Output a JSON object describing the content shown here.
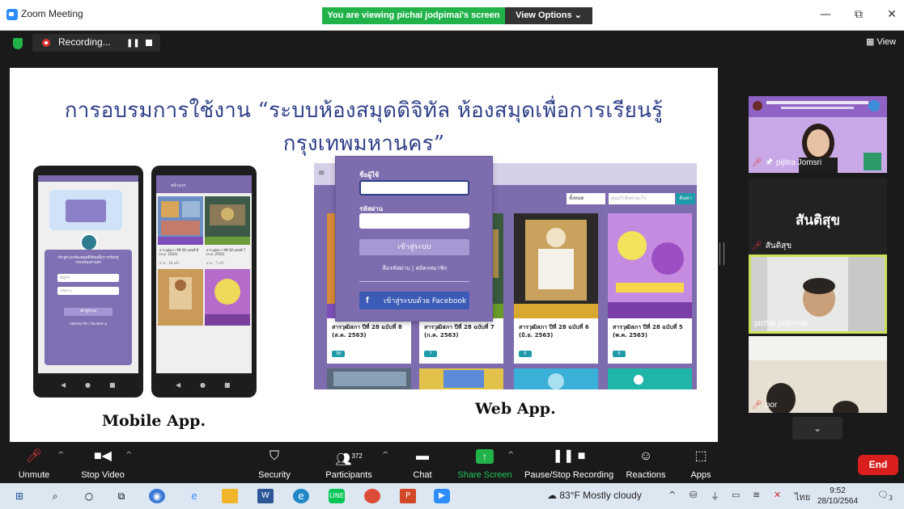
{
  "window": {
    "title": "Zoom Meeting",
    "banner_text": "You are viewing pichai jodpimai's screen",
    "view_options_label": "View Options ⌄",
    "minimize": "—",
    "maximize": "⧉",
    "close": "✕"
  },
  "recording": {
    "label": "Recording...",
    "pause_glyph": "❚❚"
  },
  "view_label": "View",
  "slide": {
    "title": "การอบรมการใช้งาน “ระบบห้องสมุดดิจิทัล ห้องสมุดเพื่อการเรียนรู้ กรุงเทพมหานคร”",
    "mobile_caption": "Mobile App.",
    "web_caption": "Web App."
  },
  "mobile_login": {
    "heading": "เข้าสู่ระบบห้องสมุดดิจิทัลเพื่อการเรียนรู้ กรุงเทพมหานคร",
    "username_placeholder": "ชื่อผู้ใช้",
    "password_placeholder": "รหัสผ่าน",
    "login_button": "เข้าสู่ระบบ",
    "links": "สมัครสมาชิก | ลืมรหัสผ่าน"
  },
  "mobile_list": {
    "header": "หน้าแรก",
    "items": [
      {
        "title": "สารวุฒิสภา ปีที่ 28 ฉบับที่ 8 (ส.ค. 2563)",
        "views": "อ่าน : 38 ครั้ง"
      },
      {
        "title": "สารวุฒิสภา ปีที่ 28 ฉบับที่ 7 (ก.ค. 2563)",
        "views": "อ่าน : 7 ครั้ง"
      }
    ]
  },
  "web_login": {
    "username_label": "ชื่อผู้ใช้",
    "password_label": "รหัสผ่าน",
    "login_button": "เข้าสู่ระบบ",
    "links": "ลืมรหัสผ่าน | สมัครสมาชิก",
    "facebook_button": "เข้าสู่ระบบด้วย Facebook",
    "facebook_glyph": "f"
  },
  "web_search": {
    "select_value": "ทั้งหมด",
    "placeholder": "คุณกำลังหาอะไร",
    "button": "ค้นหา"
  },
  "web_cards": [
    {
      "caption": "สารวุฒิสภา ปีที่ 28 ฉบับที่ 8 (ส.ค. 2563)",
      "views": "38"
    },
    {
      "caption": "สารวุฒิสภา ปีที่ 28 ฉบับที่ 7 (ก.ค. 2563)",
      "views": "7"
    },
    {
      "caption": "สารวุฒิสภา ปีที่ 28 ฉบับที่ 6 (มิ.ย. 2563)",
      "views": "6"
    },
    {
      "caption": "สารวุฒิสภา ปีที่ 28 ฉบับที่ 5 (พ.ค. 2563)",
      "views": "9"
    }
  ],
  "participants_panel": [
    {
      "name": "pijitra Jomsri",
      "muted": true,
      "pinned": true
    },
    {
      "name": "สันติสุข",
      "muted": true,
      "display_name": "สันติสุข"
    },
    {
      "name": "pichai jodpimai",
      "muted": false,
      "active_speaker": true
    },
    {
      "name": "por",
      "muted": true
    }
  ],
  "toolbar": {
    "unmute": "Unmute",
    "stop_video": "Stop Video",
    "security": "Security",
    "participants": "Participants",
    "participant_count": "372",
    "chat": "Chat",
    "share_screen": "Share Screen",
    "pause_stop_recording": "Pause/Stop Recording",
    "reactions": "Reactions",
    "apps": "Apps",
    "end": "End"
  },
  "taskbar": {
    "weather": "83°F  Mostly cloudy",
    "language": "ไทย",
    "time": "9:52",
    "date": "28/10/2564",
    "notification_count": "3"
  }
}
